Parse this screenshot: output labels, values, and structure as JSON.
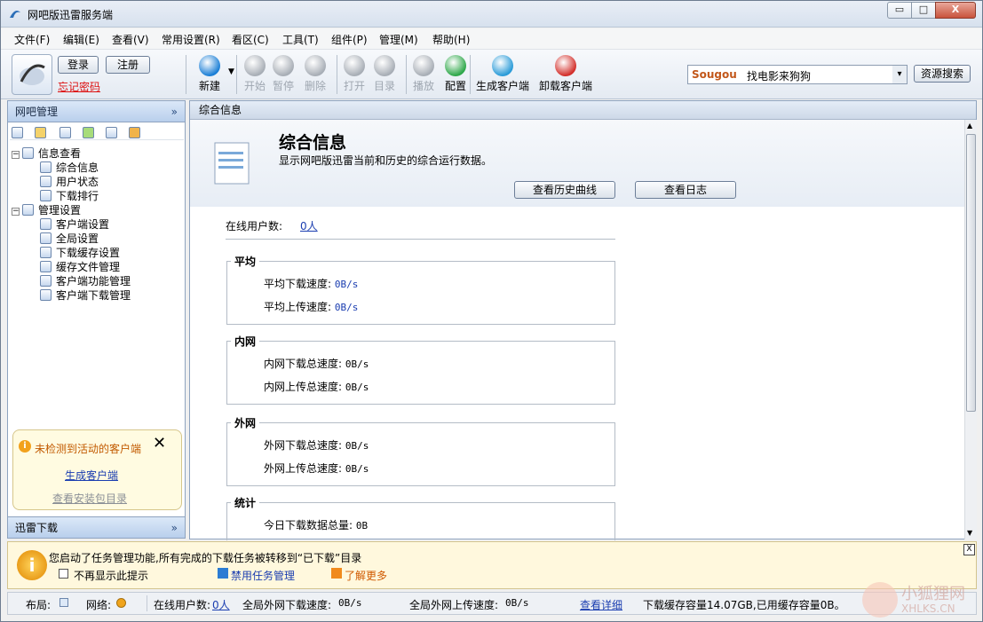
{
  "window": {
    "title": "网吧版迅雷服务端",
    "controls": {
      "minimize": "▭",
      "maximize": "□",
      "close": "X"
    }
  },
  "menu": [
    "文件(F)",
    "编辑(E)",
    "查看(V)",
    "常用设置(R)",
    "看区(C)",
    "工具(T)",
    "组件(P)",
    "管理(M)",
    "帮助(H)"
  ],
  "account": {
    "login": "登录",
    "register": "注册",
    "forgot": "忘记密码"
  },
  "toolbar": [
    {
      "label": "新建",
      "icon": "new-icon",
      "color": "#1b7fd6",
      "enabled": true
    },
    {
      "label": "开始",
      "icon": "start-icon",
      "color": "#a8aeb6",
      "enabled": false
    },
    {
      "label": "暂停",
      "icon": "pause-icon",
      "color": "#a8aeb6",
      "enabled": false
    },
    {
      "label": "删除",
      "icon": "delete-icon",
      "color": "#a8aeb6",
      "enabled": false
    },
    {
      "label": "打开",
      "icon": "play-icon",
      "color": "#a8aeb6",
      "enabled": false
    },
    {
      "label": "目录",
      "icon": "folder-icon",
      "color": "#a8aeb6",
      "enabled": false
    },
    {
      "label": "播放",
      "icon": "video-icon",
      "color": "#a8aeb6",
      "enabled": false
    },
    {
      "label": "配置",
      "icon": "config-icon",
      "color": "#2fa84a",
      "enabled": true
    },
    {
      "label": "生成客户端",
      "icon": "generate-client-icon",
      "color": "#2a9bd8",
      "enabled": true
    },
    {
      "label": "卸载客户端",
      "icon": "uninstall-client-icon",
      "color": "#d3302c",
      "enabled": true
    }
  ],
  "search": {
    "engine": "Sougou",
    "placeholder": "找电影来狗狗",
    "button": "资源搜索"
  },
  "left": {
    "header": "网吧管理",
    "tree": [
      {
        "label": "信息查看",
        "level": 0,
        "expanded": true
      },
      {
        "label": "综合信息",
        "level": 1
      },
      {
        "label": "用户状态",
        "level": 1
      },
      {
        "label": "下载排行",
        "level": 1
      },
      {
        "label": "管理设置",
        "level": 0,
        "expanded": true
      },
      {
        "label": "客户端设置",
        "level": 1
      },
      {
        "label": "全局设置",
        "level": 1
      },
      {
        "label": "下载缓存设置",
        "level": 1
      },
      {
        "label": "缓存文件管理",
        "level": 1
      },
      {
        "label": "客户端功能管理",
        "level": 1
      },
      {
        "label": "客户端下载管理",
        "level": 1
      }
    ],
    "warning": {
      "text": "未检测到活动的客户端",
      "link1": "生成客户端",
      "link2": "查看安装包目录"
    },
    "footer": "迅雷下载"
  },
  "main": {
    "tab": "综合信息",
    "title": "综合信息",
    "subtitle": "显示网吧版迅雷当前和历史的综合运行数据。",
    "btn_history": "查看历史曲线",
    "btn_log": "查看日志",
    "online_label": "在线用户数:",
    "online_value": "0人",
    "groups": [
      {
        "title": "平均",
        "rows": [
          [
            "平均下载速度:",
            "0B/s"
          ],
          [
            "平均上传速度:",
            "0B/s"
          ]
        ]
      },
      {
        "title": "内网",
        "rows": [
          [
            "内网下载总速度:",
            "0B/s"
          ],
          [
            "内网上传总速度:",
            "0B/s"
          ]
        ]
      },
      {
        "title": "外网",
        "rows": [
          [
            "外网下载总速度:",
            "0B/s"
          ],
          [
            "外网上传总速度:",
            "0B/s"
          ]
        ]
      },
      {
        "title": "统计",
        "rows": [
          [
            "今日下载数据总量:",
            "0B"
          ]
        ]
      }
    ]
  },
  "notification": {
    "text": "您启动了任务管理功能,所有完成的下载任务被转移到“已下载”目录",
    "checkbox": "不再显示此提示",
    "link_disable": "禁用任务管理",
    "link_more": "了解更多",
    "close": "X"
  },
  "status": {
    "layout_label": "布局:",
    "network_label": "网络:",
    "online_label": "在线用户数:",
    "online_value": "0人",
    "lan_label": "全局外网下载速度:",
    "lan_value": "0B/s",
    "wan_label": "全局外网上传速度:",
    "wan_value": "0B/s",
    "details": "查看详细",
    "cache": "下载缓存容量14.07GB,已用缓存容量0B。"
  },
  "watermark": {
    "cn": "小狐狸网",
    "en": "XHLKS.CN"
  }
}
